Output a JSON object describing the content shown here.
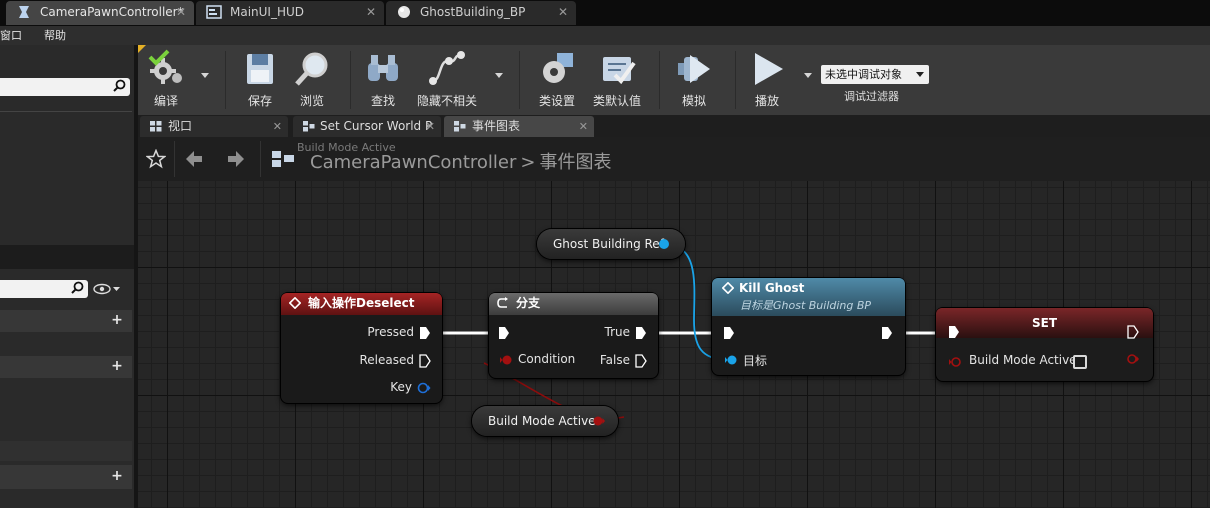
{
  "doc_tabs": [
    {
      "label": "CameraPawnController*",
      "icon": "blueprint-controller-icon"
    },
    {
      "label": "MainUI_HUD",
      "icon": "widget-blueprint-icon"
    },
    {
      "label": "GhostBuilding_BP",
      "icon": "sphere-actor-icon"
    }
  ],
  "menu": [
    "窗口",
    "帮助"
  ],
  "toolbar": {
    "compile": "编译",
    "save": "保存",
    "browse": "浏览",
    "find": "查找",
    "hide_unrelated": "隐藏不相关",
    "class_settings": "类设置",
    "class_defaults": "类默认值",
    "simulate": "模拟",
    "play": "播放",
    "debug_target": "未选中调试对象",
    "debug_filter": "调试过滤器"
  },
  "sub_tabs": [
    {
      "label": "视口"
    },
    {
      "label": "Set Cursor World P"
    },
    {
      "label": "事件图表"
    }
  ],
  "graph": {
    "watermark": "Build Mode Active",
    "breadcrumb_root": "CameraPawnController",
    "breadcrumb_sep": ">",
    "breadcrumb_leaf": "事件图表"
  },
  "nodes": {
    "input_action": {
      "title": "输入操作Deselect",
      "pins": [
        "Pressed",
        "Released",
        "Key"
      ]
    },
    "branch": {
      "title": "分支",
      "in_pin": "Condition",
      "out_true": "True",
      "out_false": "False"
    },
    "kill_ghost": {
      "title": "Kill Ghost",
      "subtitle": "目标是Ghost Building BP",
      "target_pin": "目标"
    },
    "set": {
      "title": "SET",
      "pin": "Build Mode Active"
    },
    "ghost_ref": {
      "label": "Ghost Building Ref"
    },
    "build_mode_get": {
      "label": "Build Mode Active"
    }
  },
  "colors": {
    "exec": "#ffffff",
    "bool_pin": "#8c0c0c",
    "object_pin": "#1aa3e8",
    "input_header": "#8a1b1b",
    "kill_header": "#3d6b82",
    "set_header": "#6b1f22"
  }
}
